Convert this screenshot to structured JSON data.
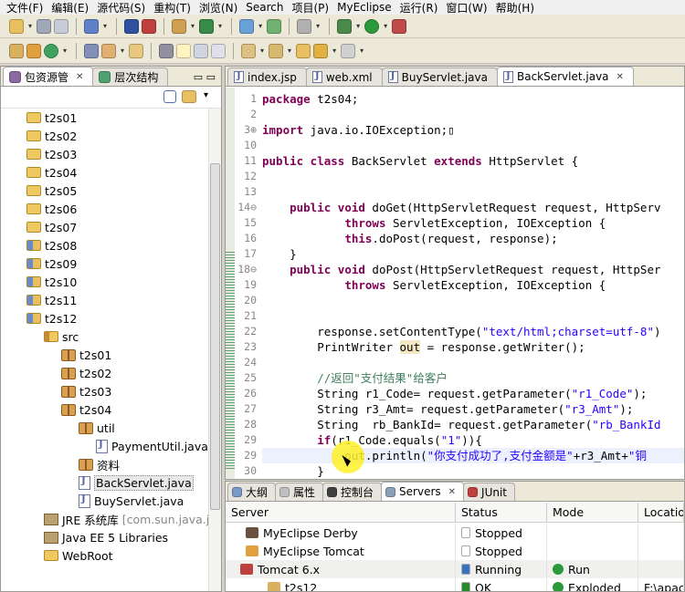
{
  "menubar": {
    "items": [
      "文件(F)",
      "编辑(E)",
      "源代码(S)",
      "重构(T)",
      "浏览(N)",
      "Search",
      "项目(P)",
      "MyEclipse",
      "运行(R)",
      "窗口(W)",
      "帮助(H)"
    ]
  },
  "explorer": {
    "tabs": [
      "包资源管",
      "层次结构"
    ],
    "tree": [
      {
        "label": "t2s01",
        "type": "folder",
        "indent": 0
      },
      {
        "label": "t2s02",
        "type": "folder",
        "indent": 0
      },
      {
        "label": "t2s03",
        "type": "folder",
        "indent": 0
      },
      {
        "label": "t2s04",
        "type": "folder",
        "indent": 0
      },
      {
        "label": "t2s05",
        "type": "folder",
        "indent": 0
      },
      {
        "label": "t2s06",
        "type": "folder",
        "indent": 0
      },
      {
        "label": "t2s07",
        "type": "folder",
        "indent": 0
      },
      {
        "label": "t2s08",
        "type": "webproject",
        "indent": 0
      },
      {
        "label": "t2s09",
        "type": "webproject",
        "indent": 0
      },
      {
        "label": "t2s10",
        "type": "webproject",
        "indent": 0
      },
      {
        "label": "t2s11",
        "type": "webproject",
        "indent": 0
      },
      {
        "label": "t2s12",
        "type": "webproject",
        "indent": 0
      },
      {
        "label": "src",
        "type": "src",
        "indent": 1
      },
      {
        "label": "t2s01",
        "type": "package",
        "indent": 2
      },
      {
        "label": "t2s02",
        "type": "package",
        "indent": 2
      },
      {
        "label": "t2s03",
        "type": "package",
        "indent": 2
      },
      {
        "label": "t2s04",
        "type": "package",
        "indent": 2
      },
      {
        "label": "util",
        "type": "package",
        "indent": 3
      },
      {
        "label": "PaymentUtil.java",
        "type": "java",
        "indent": 4
      },
      {
        "label": "资料",
        "type": "package",
        "indent": 3
      },
      {
        "label": "BackServlet.java",
        "type": "java",
        "indent": 3,
        "selected": true
      },
      {
        "label": "BuyServlet.java",
        "type": "java",
        "indent": 3
      },
      {
        "label": "JRE 系统库",
        "extra": "[com.sun.java.jc",
        "type": "lib",
        "indent": 1
      },
      {
        "label": "Java EE 5 Libraries",
        "type": "lib",
        "indent": 1
      },
      {
        "label": "WebRoot",
        "type": "folder",
        "indent": 1
      }
    ]
  },
  "editor": {
    "tabs": [
      {
        "label": "index.jsp",
        "active": false
      },
      {
        "label": "web.xml",
        "active": false
      },
      {
        "label": "BuyServlet.java",
        "active": false
      },
      {
        "label": "BackServlet.java",
        "active": true
      }
    ],
    "lines": [
      {
        "no": "1",
        "html": "<span class='kw'>package</span> t2s04;"
      },
      {
        "no": "2",
        "html": ""
      },
      {
        "no": "3⊕",
        "html": "<span class='kw'>import</span> java.io.IOException;▯"
      },
      {
        "no": "10",
        "html": ""
      },
      {
        "no": "11",
        "html": "<span class='kw'>public class</span> BackServlet <span class='kw'>extends</span> HttpServlet {"
      },
      {
        "no": "12",
        "html": ""
      },
      {
        "no": "13",
        "html": ""
      },
      {
        "no": "14⊖",
        "html": "    <span class='kw'>public void</span> doGet(HttpServletRequest request, HttpServ"
      },
      {
        "no": "15",
        "html": "            <span class='kw'>throws</span> ServletException, IOException {"
      },
      {
        "no": "16",
        "html": "            <span class='kw'>this</span>.doPost(request, response);"
      },
      {
        "no": "17",
        "html": "    }"
      },
      {
        "no": "18⊖",
        "html": "    <span class='kw'>public void</span> doPost(HttpServletRequest request, HttpSer"
      },
      {
        "no": "19",
        "html": "            <span class='kw'>throws</span> ServletException, IOException {"
      },
      {
        "no": "20",
        "html": ""
      },
      {
        "no": "21",
        "html": ""
      },
      {
        "no": "22",
        "html": "        response.setContentType(<span class='str'>\"text/html;charset=utf-8\"</span>)"
      },
      {
        "no": "23",
        "html": "        PrintWriter <span style='background:#f4e8c4'>out</span> = response.getWriter();"
      },
      {
        "no": "24",
        "html": ""
      },
      {
        "no": "25",
        "html": "        <span class='cm'>//返回\"支付结果\"给客户</span>"
      },
      {
        "no": "26",
        "html": "        String r1_Code= request.getParameter(<span class='str'>\"r1_Code\"</span>);"
      },
      {
        "no": "27",
        "html": "        String r3_Amt= request.getParameter(<span class='str'>\"r3_Amt\"</span>);"
      },
      {
        "no": "28",
        "html": "        String  rb_BankId= request.getParameter(<span class='str'>\"rb_BankId</span>"
      },
      {
        "no": "29",
        "html": "        <span class='kw'>if</span>(r1_Code.equals(<span class='str'>\"1\"</span>)){"
      },
      {
        "no": "29",
        "html": "            out.println(<span class='str'>\"你支付成功了,支付金额是\"</span>+r3_Amt+<span class='str'>\"铜</span>"
      },
      {
        "no": "30",
        "html": "        }"
      }
    ]
  },
  "bottom": {
    "tabs": [
      {
        "label": "大纲",
        "active": false
      },
      {
        "label": "属性",
        "active": false
      },
      {
        "label": "控制台",
        "active": false
      },
      {
        "label": "Servers",
        "active": true
      },
      {
        "label": "JUnit",
        "active": false
      }
    ],
    "columns": [
      "Server",
      "Status",
      "Mode",
      "Location"
    ],
    "rows": [
      {
        "server": "MyEclipse Derby",
        "status": "Stopped",
        "mode": "",
        "location": ""
      },
      {
        "server": "MyEclipse Tomcat",
        "status": "Stopped",
        "mode": "",
        "location": ""
      },
      {
        "server": "Tomcat  6.x",
        "status": "Running",
        "mode": "Run",
        "location": ""
      },
      {
        "server": "t2s12",
        "status": "OK",
        "mode": "Exploded",
        "location": "F:\\apach"
      }
    ]
  }
}
